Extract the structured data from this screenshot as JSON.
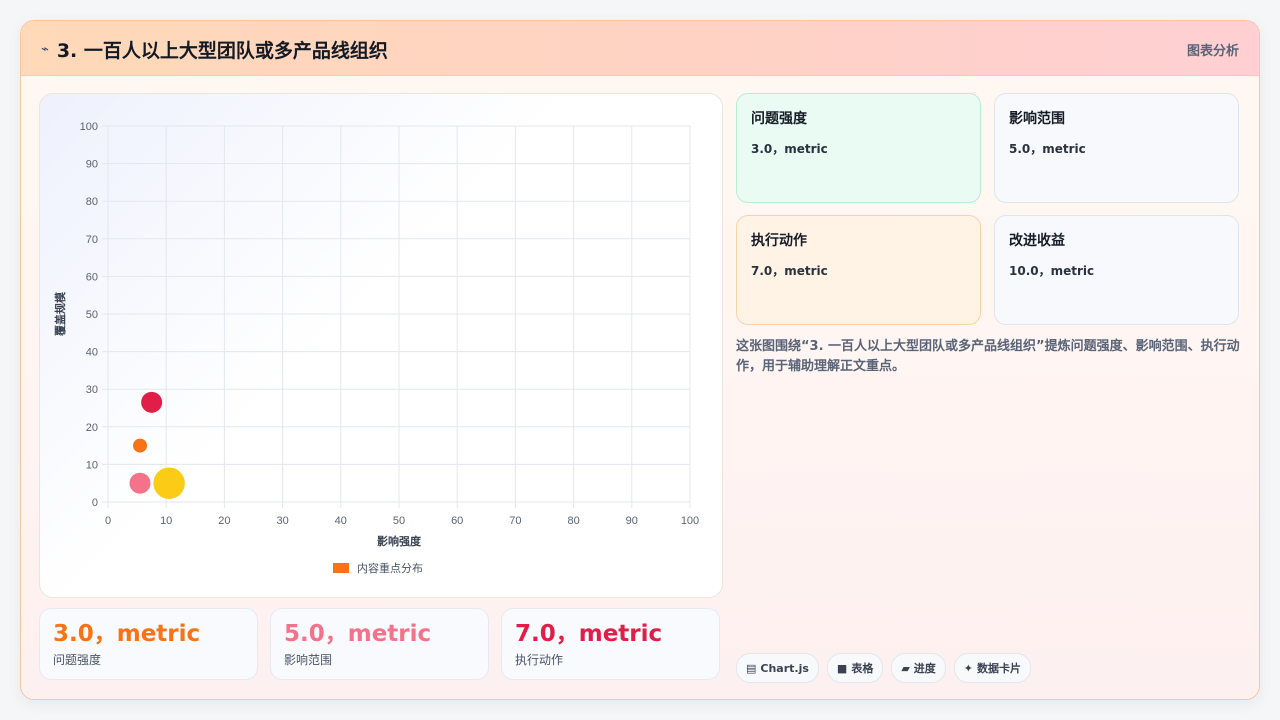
{
  "header": {
    "icon": "sparkline-icon",
    "title": "3. 一百人以上大型团队或多产品线组织",
    "right_label": "图表分析"
  },
  "chart_data": {
    "type": "scatter",
    "title": "",
    "xlabel": "影响强度",
    "ylabel": "覆盖规模",
    "xlim": [
      0,
      100
    ],
    "ylim": [
      0,
      100
    ],
    "xticks": [
      0,
      10,
      20,
      30,
      40,
      50,
      60,
      70,
      80,
      90,
      100
    ],
    "yticks": [
      0,
      10,
      20,
      30,
      40,
      50,
      60,
      70,
      80,
      90,
      100
    ],
    "grid": true,
    "legend_position": "bottom",
    "series": [
      {
        "name": "内容重点分布",
        "color": "#f97316",
        "points": [
          {
            "x": 5.5,
            "y": 5,
            "r": 3,
            "color": "#f4728a"
          },
          {
            "x": 5.5,
            "y": 15,
            "r": 2,
            "color": "#f97316"
          },
          {
            "x": 7.5,
            "y": 26.5,
            "r": 3,
            "color": "#e11d48"
          },
          {
            "x": 10.5,
            "y": 5,
            "r": 4.5,
            "color": "#facc15"
          }
        ]
      }
    ]
  },
  "metrics": [
    {
      "title": "问题强度",
      "value": "3.0，metric"
    },
    {
      "title": "影响范围",
      "value": "5.0，metric"
    },
    {
      "title": "执行动作",
      "value": "7.0，metric"
    },
    {
      "title": "改进收益",
      "value": "10.0，metric"
    }
  ],
  "description": "这张图围绕“3. 一百人以上大型团队或多产品线组织”提炼问题强度、影响范围、执行动作，用于辅助理解正文重点。",
  "stats": [
    {
      "value": "3.0，metric",
      "label": "问题强度",
      "color": "#f97316"
    },
    {
      "value": "5.0，metric",
      "label": "影响范围",
      "color": "#f4728a"
    },
    {
      "value": "7.0，metric",
      "label": "执行动作",
      "color": "#e11d48"
    }
  ],
  "tags": [
    {
      "icon": "chart-icon",
      "glyph": "▤",
      "label": "Chart.js"
    },
    {
      "icon": "table-icon",
      "glyph": "■",
      "label": "表格"
    },
    {
      "icon": "progress-icon",
      "glyph": "▰",
      "label": "进度"
    },
    {
      "icon": "sparkle-icon",
      "glyph": "✦",
      "label": "数据卡片"
    }
  ]
}
